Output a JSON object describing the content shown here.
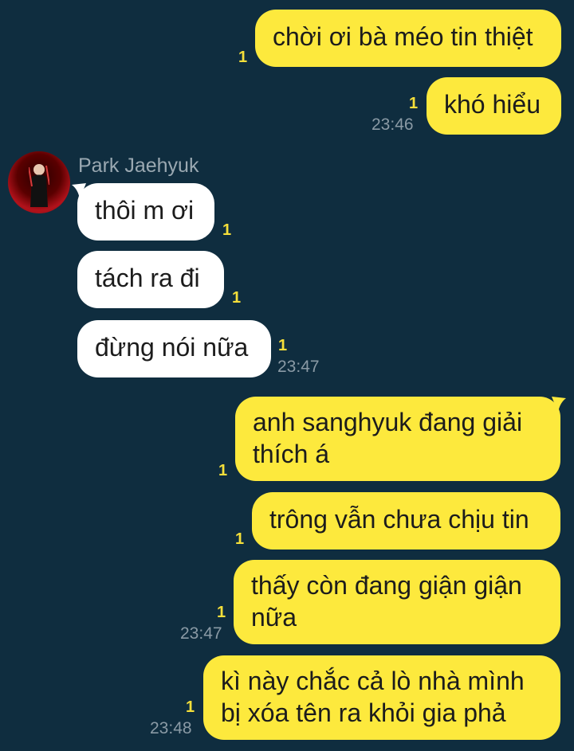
{
  "chat": {
    "contact_name": "Park Jaehyuk",
    "messages": [
      {
        "text": "chời ơi bà méo tin thiệt",
        "unread": "1"
      },
      {
        "text": "khó hiểu",
        "unread": "1",
        "time": "23:46"
      },
      {
        "text": "thôi m ơi",
        "unread": "1"
      },
      {
        "text": "tách ra đi",
        "unread": "1"
      },
      {
        "text": "đừng nói nữa",
        "unread": "1",
        "time": "23:47"
      },
      {
        "text": "anh sanghyuk đang giải thích á",
        "unread": "1"
      },
      {
        "text": "trông vẫn chưa chịu tin",
        "unread": "1"
      },
      {
        "text": "thấy còn đang giận giận nữa",
        "unread": "1",
        "time": "23:47"
      },
      {
        "text": "kì này chắc cả lò nhà mình bị xóa tên ra khỏi gia phả",
        "unread": "1",
        "time": "23:48"
      }
    ]
  },
  "colors": {
    "background": "#0f2d3f",
    "outgoing_bubble": "#fde93d",
    "incoming_bubble": "#ffffff",
    "unread_count": "#f5df3a"
  }
}
